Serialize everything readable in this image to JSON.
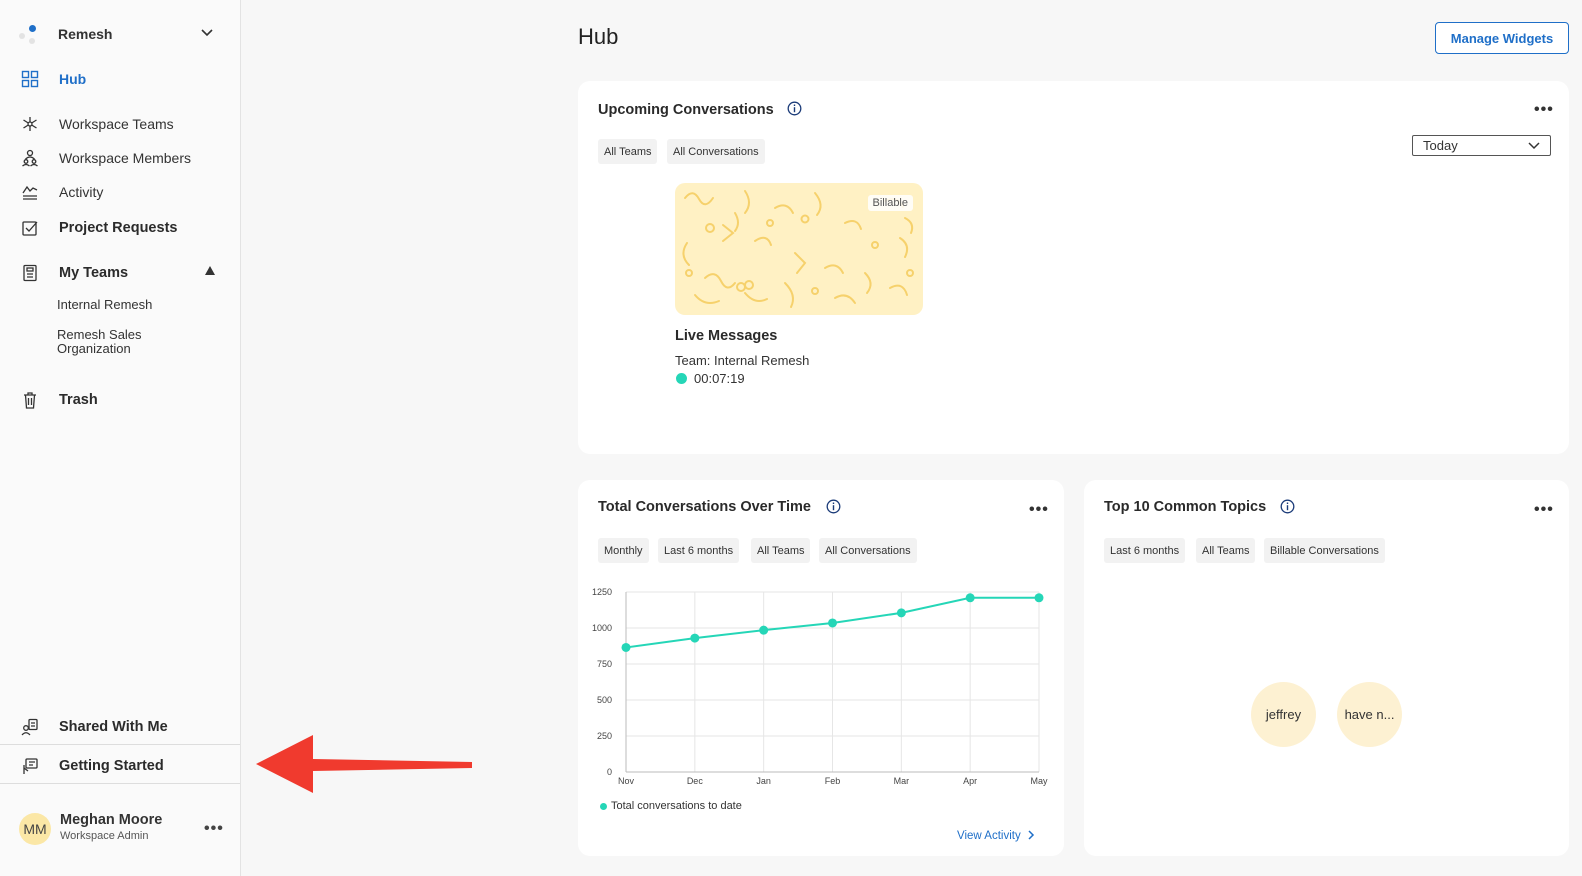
{
  "sidebar": {
    "org_name": "Remesh",
    "nav": {
      "hub": "Hub",
      "workspace_teams": "Workspace Teams",
      "workspace_members": "Workspace Members",
      "activity": "Activity",
      "project_requests": "Project Requests",
      "my_teams": "My Teams",
      "trash": "Trash",
      "shared_with_me": "Shared With Me",
      "getting_started": "Getting Started"
    },
    "teams": [
      "Internal Remesh",
      "Remesh Sales Organization"
    ],
    "user": {
      "initials": "MM",
      "name": "Meghan Moore",
      "role": "Workspace Admin"
    }
  },
  "header": {
    "title": "Hub",
    "manage_widgets": "Manage Widgets"
  },
  "upcoming": {
    "title": "Upcoming Conversations",
    "filters": [
      "All Teams",
      "All Conversations"
    ],
    "range_select": "Today",
    "conversation": {
      "badge": "Billable",
      "title": "Live Messages",
      "team": "Team: Internal Remesh",
      "elapsed": "00:07:19",
      "status_color": "#25d6b7"
    }
  },
  "total_conversations": {
    "title": "Total Conversations Over Time",
    "filters": [
      "Monthly",
      "Last 6 months",
      "All Teams",
      "All Conversations"
    ],
    "view_link": "View Activity"
  },
  "topics": {
    "title": "Top 10 Common Topics",
    "filters": [
      "Last 6 months",
      "All Teams",
      "Billable Conversations"
    ],
    "items": [
      "jeffrey",
      "have n..."
    ]
  },
  "colors": {
    "accent": "#1f6fc8",
    "series": "#25d6b7",
    "arrow": "#f03a2e"
  },
  "chart_data": {
    "type": "line",
    "title": "Total Conversations Over Time",
    "categories": [
      "Nov",
      "Dec",
      "Jan",
      "Feb",
      "Mar",
      "Apr",
      "May"
    ],
    "series": [
      {
        "name": "Total conversations to date",
        "values": [
          865,
          930,
          985,
          1035,
          1105,
          1210,
          1210
        ]
      }
    ],
    "ylim": [
      0,
      1250
    ],
    "yticks": [
      0,
      250,
      500,
      750,
      1000,
      1250
    ],
    "grid": true,
    "legend": "bottom-left"
  }
}
